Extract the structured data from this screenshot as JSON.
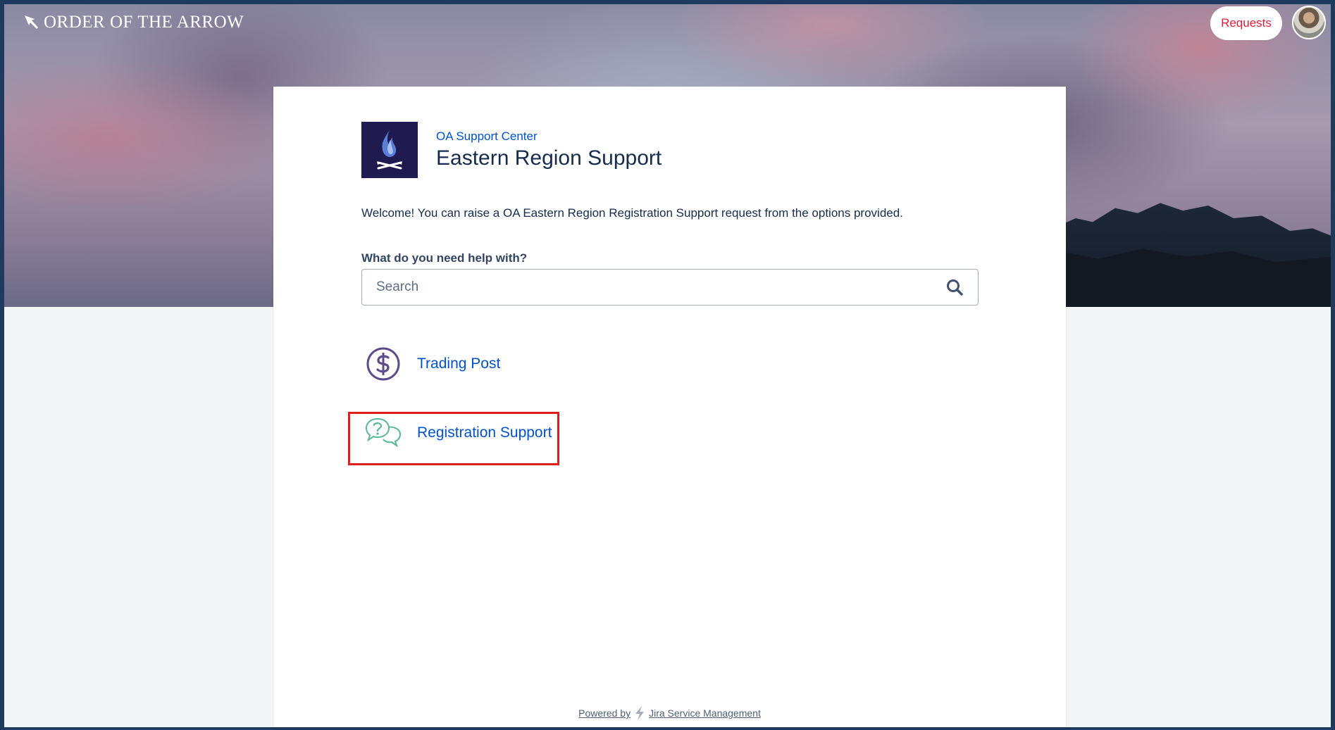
{
  "brand": {
    "name": "ORDER OF THE ARROW"
  },
  "topbar": {
    "requests_label": "Requests",
    "avatar_icon": "user-avatar"
  },
  "portal": {
    "breadcrumb": "OA Support Center",
    "title": "Eastern Region Support",
    "logo_icon": "flame-arrows-logo",
    "welcome": "Welcome! You can raise a OA Eastern Region Registration Support request from the options provided.",
    "help_label": "What do you need help with?",
    "search": {
      "placeholder": "Search",
      "value": ""
    }
  },
  "request_types": [
    {
      "label": "Trading Post",
      "icon": "dollar-circle-icon"
    },
    {
      "label": "Registration Support",
      "icon": "question-chat-bubbles-icon"
    }
  ],
  "footer": {
    "powered_by": "Powered by",
    "product": "Jira Service Management"
  },
  "colors": {
    "link": "#0052cc",
    "title": "#172b4d",
    "requests_text": "#e01e3c",
    "highlight": "#e01e1e",
    "trading_icon": "#5e4b8b",
    "registration_icon": "#57b894"
  }
}
